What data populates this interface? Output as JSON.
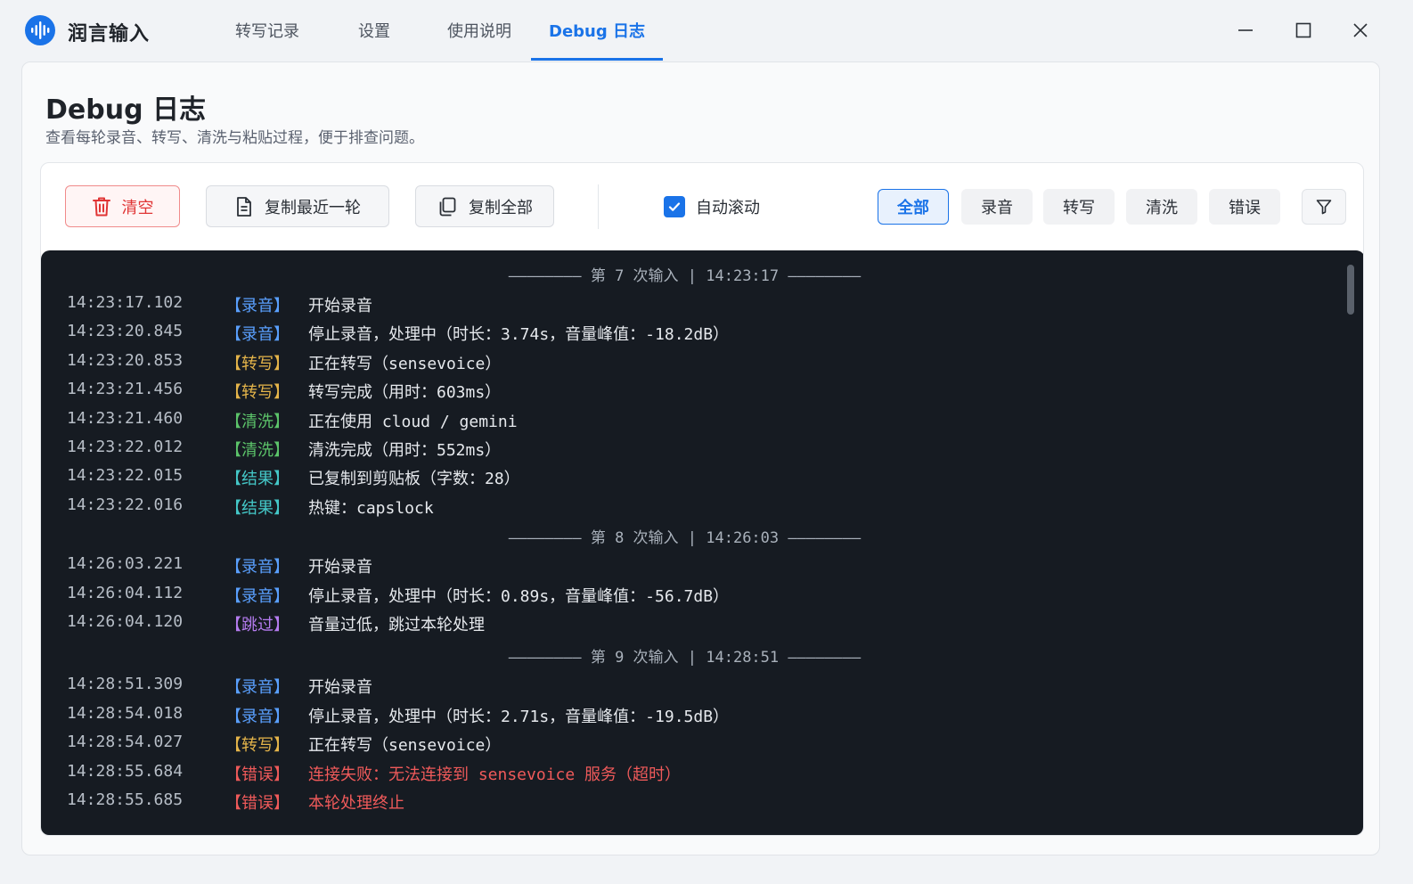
{
  "app": {
    "name": "润言输入",
    "logo_icon": "sound-wave-icon",
    "accent": "#1a73e8"
  },
  "tabs": [
    {
      "label": "转写记录"
    },
    {
      "label": "设置"
    },
    {
      "label": "使用说明"
    },
    {
      "label": "Debug 日志",
      "active": true
    }
  ],
  "page": {
    "title": "Debug 日志",
    "subtitle": "查看每轮录音、转写、清洗与粘贴过程，便于排查问题。"
  },
  "toolbar": {
    "clear_label": "清空",
    "copy_last_label": "复制最近一轮",
    "copy_all_label": "复制全部",
    "auto_scroll_label": "自动滚动",
    "auto_scroll_checked": true,
    "filters": [
      {
        "label": "全部",
        "active": true
      },
      {
        "label": "录音"
      },
      {
        "label": "转写"
      },
      {
        "label": "清洗"
      },
      {
        "label": "错误"
      }
    ]
  },
  "log": {
    "sessions": [
      {
        "header": "———————— 第 7 次输入 | 14:23:17 ————————",
        "entries": [
          {
            "time": "14:23:17.102",
            "tag": "【录音】",
            "kind": "rec",
            "msg": "开始录音"
          },
          {
            "time": "14:23:20.845",
            "tag": "【录音】",
            "kind": "rec",
            "msg": "停止录音，处理中（时长：3.74s，音量峰值：-18.2dB）"
          },
          {
            "time": "14:23:20.853",
            "tag": "【转写】",
            "kind": "trans",
            "msg": "正在转写（sensevoice）"
          },
          {
            "time": "14:23:21.456",
            "tag": "【转写】",
            "kind": "trans",
            "msg": "转写完成（用时：603ms）"
          },
          {
            "time": "14:23:21.460",
            "tag": "【清洗】",
            "kind": "clean",
            "msg": "正在使用 cloud / gemini"
          },
          {
            "time": "14:23:22.012",
            "tag": "【清洗】",
            "kind": "clean",
            "msg": "清洗完成（用时：552ms）"
          },
          {
            "time": "14:23:22.015",
            "tag": "【结果】",
            "kind": "result",
            "msg": "已复制到剪贴板（字数：28）"
          },
          {
            "time": "14:23:22.016",
            "tag": "【结果】",
            "kind": "result",
            "msg": "热键：capslock"
          }
        ]
      },
      {
        "header": "———————— 第 8 次输入 | 14:26:03 ————————",
        "entries": [
          {
            "time": "14:26:03.221",
            "tag": "【录音】",
            "kind": "rec",
            "msg": "开始录音"
          },
          {
            "time": "14:26:04.112",
            "tag": "【录音】",
            "kind": "rec",
            "msg": "停止录音，处理中（时长：0.89s，音量峰值：-56.7dB）"
          },
          {
            "time": "14:26:04.120",
            "tag": "【跳过】",
            "kind": "skip",
            "msg": "音量过低，跳过本轮处理"
          }
        ]
      },
      {
        "header": "———————— 第 9 次输入 | 14:28:51 ————————",
        "entries": [
          {
            "time": "14:28:51.309",
            "tag": "【录音】",
            "kind": "rec",
            "msg": "开始录音"
          },
          {
            "time": "14:28:54.018",
            "tag": "【录音】",
            "kind": "rec",
            "msg": "停止录音，处理中（时长：2.71s，音量峰值：-19.5dB）"
          },
          {
            "time": "14:28:54.027",
            "tag": "【转写】",
            "kind": "trans",
            "msg": "正在转写（sensevoice）"
          },
          {
            "time": "14:28:55.684",
            "tag": "【错误】",
            "kind": "err",
            "msg": "连接失败：无法连接到 sensevoice 服务（超时）"
          },
          {
            "time": "14:28:55.685",
            "tag": "【错误】",
            "kind": "err",
            "msg": "本轮处理终止"
          }
        ]
      }
    ]
  }
}
